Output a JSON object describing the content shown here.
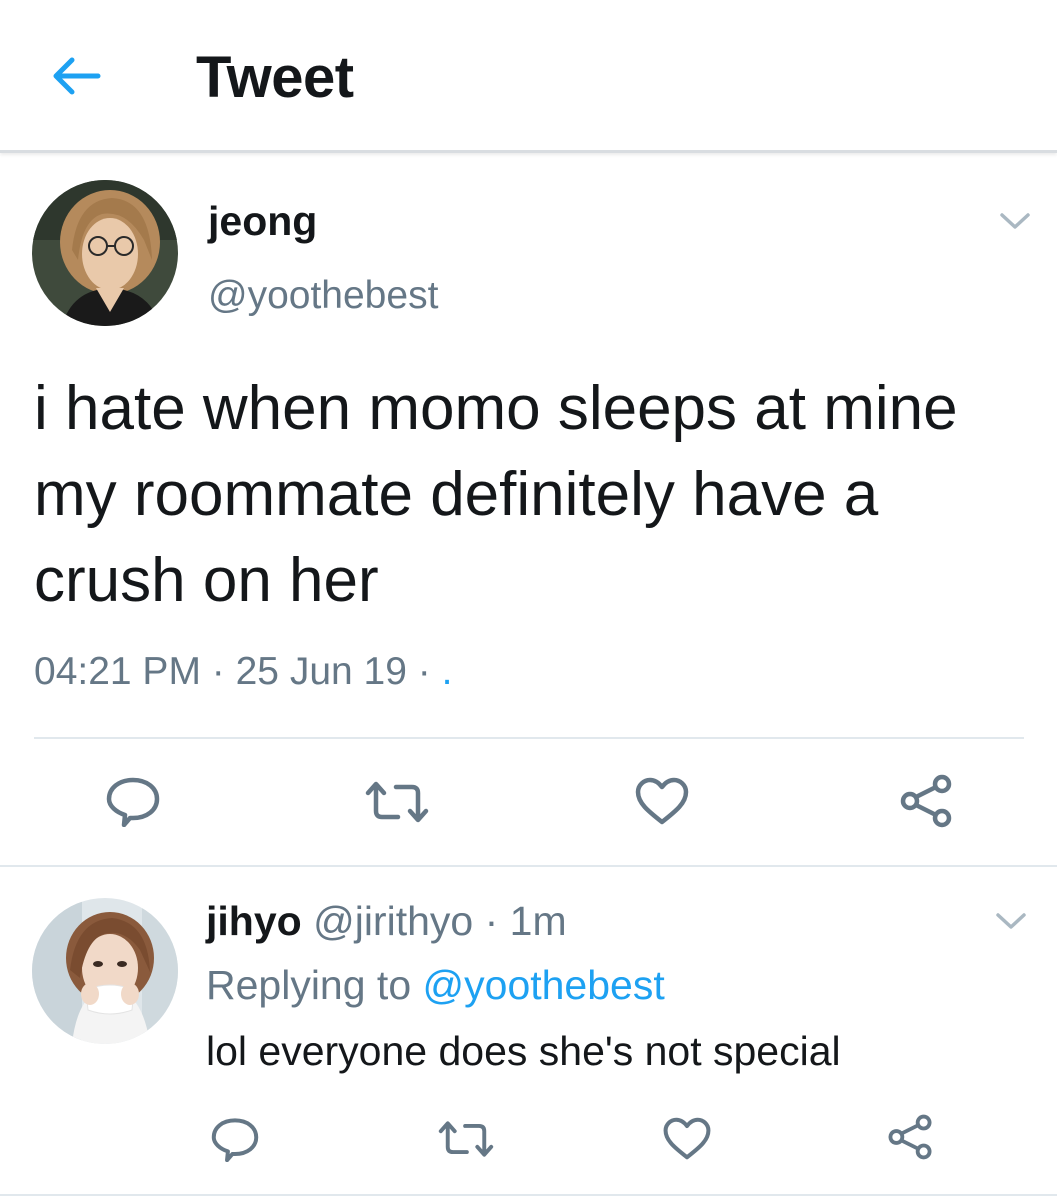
{
  "header": {
    "title": "Tweet"
  },
  "tweet": {
    "author_name": "jeong",
    "author_handle": "@yoothebest",
    "text": "i hate when momo sleeps at mine my roommate definitely have a crush on her",
    "time": "04:21 PM",
    "date": "25 Jun 19",
    "separator": " · ",
    "source": "."
  },
  "reply": {
    "author_name": "jihyo",
    "author_handle": "@jirithyo",
    "separator": " · ",
    "age": "1m",
    "replying_to_label": "Replying to ",
    "replying_to_handle": "@yoothebest",
    "text": "lol everyone does she's not special"
  },
  "icons": {
    "back": "arrow-left-icon",
    "caret": "chevron-down-icon",
    "reply": "speech-bubble-icon",
    "retweet": "retweet-icon",
    "like": "heart-icon",
    "share": "share-icon"
  },
  "colors": {
    "accent": "#1da1f2",
    "text": "#14171a",
    "secondary": "#657786",
    "divider": "#e1e8ed"
  }
}
